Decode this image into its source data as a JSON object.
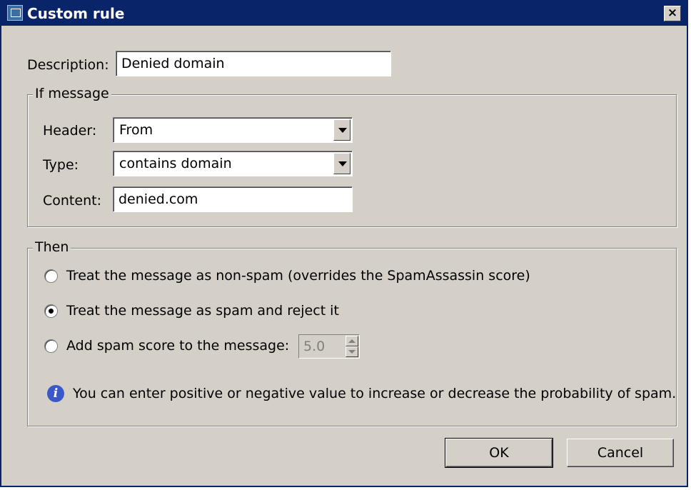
{
  "window": {
    "title": "Custom rule",
    "close_label": "×"
  },
  "description": {
    "label": "Description:",
    "value": "Denied domain"
  },
  "if_group": {
    "legend": "If message",
    "header_label": "Header:",
    "header_value": "From",
    "type_label": "Type:",
    "type_value": "contains domain",
    "content_label": "Content:",
    "content_value": "denied.com"
  },
  "then_group": {
    "legend": "Then",
    "options": [
      {
        "label": "Treat the message as non-spam (overrides the SpamAssassin score)",
        "checked": false
      },
      {
        "label": "Treat the message as spam and reject it",
        "checked": true
      },
      {
        "label": "Add spam score to the message:",
        "checked": false
      }
    ],
    "score_value": "5.0",
    "info_glyph": "i",
    "info_text": "You can enter positive or negative value to increase or decrease the probability of spam."
  },
  "buttons": {
    "ok": "OK",
    "cancel": "Cancel"
  }
}
